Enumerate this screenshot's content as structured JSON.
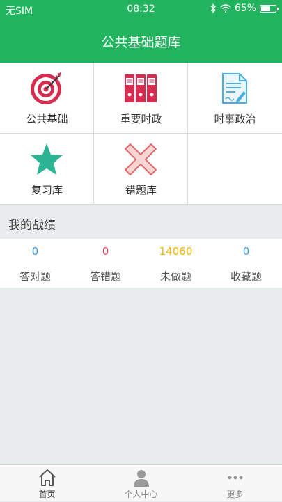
{
  "status_bar": {
    "carrier": "无SIM",
    "time": "08:32",
    "battery": "65%",
    "battery_level": 0.65
  },
  "header": {
    "title": "公共基础题库"
  },
  "grid": [
    {
      "label": "公共基础",
      "icon": "target-icon"
    },
    {
      "label": "重要时政",
      "icon": "binders-icon"
    },
    {
      "label": "时事政治",
      "icon": "document-pen-icon"
    },
    {
      "label": "复习库",
      "icon": "star-icon"
    },
    {
      "label": "错题库",
      "icon": "cross-icon"
    }
  ],
  "section": {
    "title": "我的战绩"
  },
  "stats": [
    {
      "value": "0",
      "label": "答对题",
      "color": "#3a9be0"
    },
    {
      "value": "0",
      "label": "答错题",
      "color": "#e0455a"
    },
    {
      "value": "14060",
      "label": "未做题",
      "color": "#f0b400"
    },
    {
      "value": "0",
      "label": "收藏题",
      "color": "#3a9be0"
    }
  ],
  "tabbar": [
    {
      "label": "首页",
      "icon": "home-icon",
      "active": true
    },
    {
      "label": "个人中心",
      "icon": "person-icon",
      "active": false
    },
    {
      "label": "更多",
      "icon": "more-icon",
      "active": false
    }
  ],
  "colors": {
    "primary": "#22b35e",
    "background": "#e8ecec"
  }
}
